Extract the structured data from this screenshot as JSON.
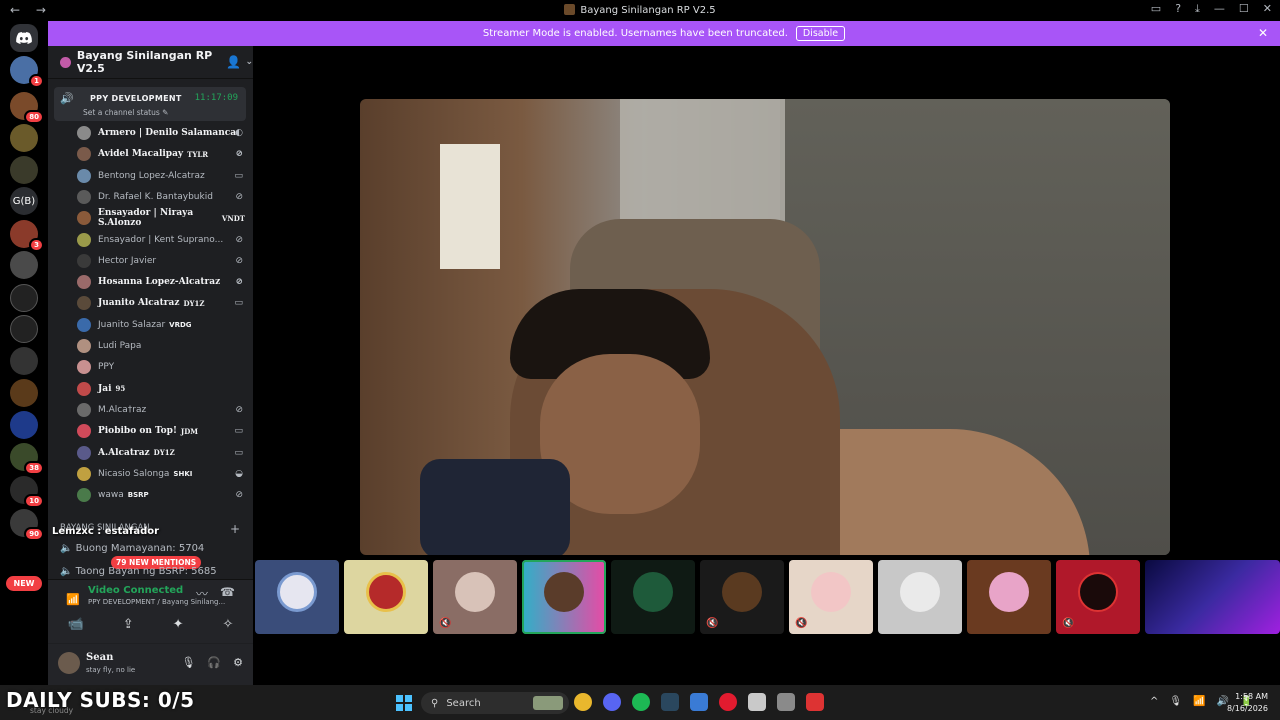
{
  "window": {
    "title": "Bayang Sinilangan RP V2.5",
    "nav": "← →",
    "controls": [
      "▭",
      "?",
      "⤓",
      "—",
      "☐",
      "✕"
    ]
  },
  "banner": {
    "text": "Streamer Mode is enabled. Usernames have been truncated.",
    "button": "Disable",
    "close": "✕"
  },
  "guilds": {
    "discord_icon": "discord-logo-icon",
    "badges": [
      "1",
      "80",
      "3",
      "38",
      "10",
      "90"
    ],
    "text_guild": "G(B)",
    "new_label": "NEW"
  },
  "server": {
    "name": "Bayang Sinilangan RP V2.5",
    "chevron": "⌄",
    "invite_icon": "add-member-icon"
  },
  "voice_channel": {
    "name": "PPY DEVELOPMENT",
    "timer": "11:17:09",
    "status": "Set a channel status ✎"
  },
  "members": [
    {
      "name": "Armero | Denilo Salamanca",
      "tag": "",
      "bold": true
    },
    {
      "name": "Avidel Macalipay",
      "tag": "TYLR",
      "bold": true
    },
    {
      "name": "Bentong Lopez-Alcatraz",
      "tag": "",
      "bold": false
    },
    {
      "name": "Dr. Rafael K. Bantaybukid",
      "tag": "",
      "bold": false
    },
    {
      "name": "Ensayador | Niraya S.Alonzo",
      "tag": "VNDT",
      "bold": true
    },
    {
      "name": "Ensayador | Kent Suprano...",
      "tag": "",
      "bold": false
    },
    {
      "name": "Hector Javier",
      "tag": "",
      "bold": false
    },
    {
      "name": "Hosanna Lopez-Alcatraz",
      "tag": "",
      "bold": true
    },
    {
      "name": "Juanito Alcatraz",
      "tag": "DY1Z",
      "bold": true
    },
    {
      "name": "Juanito Salazar",
      "tag": "VRDG",
      "bold": false
    },
    {
      "name": "Ludi Papa",
      "tag": "",
      "bold": false
    },
    {
      "name": "PPY",
      "tag": "",
      "bold": false
    },
    {
      "name": "Jai",
      "tag": "95",
      "bold": true
    },
    {
      "name": "M.Alca†raz",
      "tag": "",
      "bold": false
    },
    {
      "name": "Piobibo on Top!",
      "tag": "JDM",
      "bold": true
    },
    {
      "name": "A.Alcatraz",
      "tag": "DY1Z",
      "bold": true
    },
    {
      "name": "Nicasio Salonga",
      "tag": "SHKI",
      "bold": false
    },
    {
      "name": "wawa",
      "tag": "BSRP",
      "bold": false
    }
  ],
  "overlay": {
    "chat_user": "Lemzxc",
    "chat_text": ": estafador",
    "daily_subs": "DAILY SUBS: 0/5",
    "faint_text": "stay cloudy"
  },
  "category": {
    "name": "BAYANG SINILANGAN",
    "plus": "+"
  },
  "channels": [
    {
      "name": "Buong Mamayanan: 5704"
    },
    {
      "name": "Taong Bayan ng BSRP: 5685"
    }
  ],
  "mentions_pill": "79 NEW MENTIONS",
  "voice_connection": {
    "title": "Video Connected",
    "subtitle": "PPY DEVELOPMENT / Bayang Sinilang...",
    "noise_icon": "noise-suppression-icon",
    "disconnect_icon": "disconnect-icon"
  },
  "voice_actions": [
    "📹",
    "⇪",
    "✦",
    "✧"
  ],
  "user": {
    "name": "Sean",
    "status": "stay fly, no lie"
  },
  "user_controls": [
    "🎙",
    "🎧",
    "⚙"
  ],
  "taskbar": {
    "search_placeholder": "Search",
    "time": "1:58 AM",
    "date": "8/16/2026",
    "apps": [
      "chrome",
      "discord",
      "spotify",
      "steam",
      "notepad",
      "opera",
      "obs",
      "app",
      "app2"
    ],
    "app_colors": [
      "#e9b72d",
      "#5865f2",
      "#1db954",
      "#2a475e",
      "#3a7bd5",
      "#e21b2f",
      "#c9c9c9",
      "#8a8a8a",
      "#d33"
    ],
    "tray": [
      "^",
      "🎙",
      "📶",
      "🔊",
      "🔋"
    ]
  }
}
